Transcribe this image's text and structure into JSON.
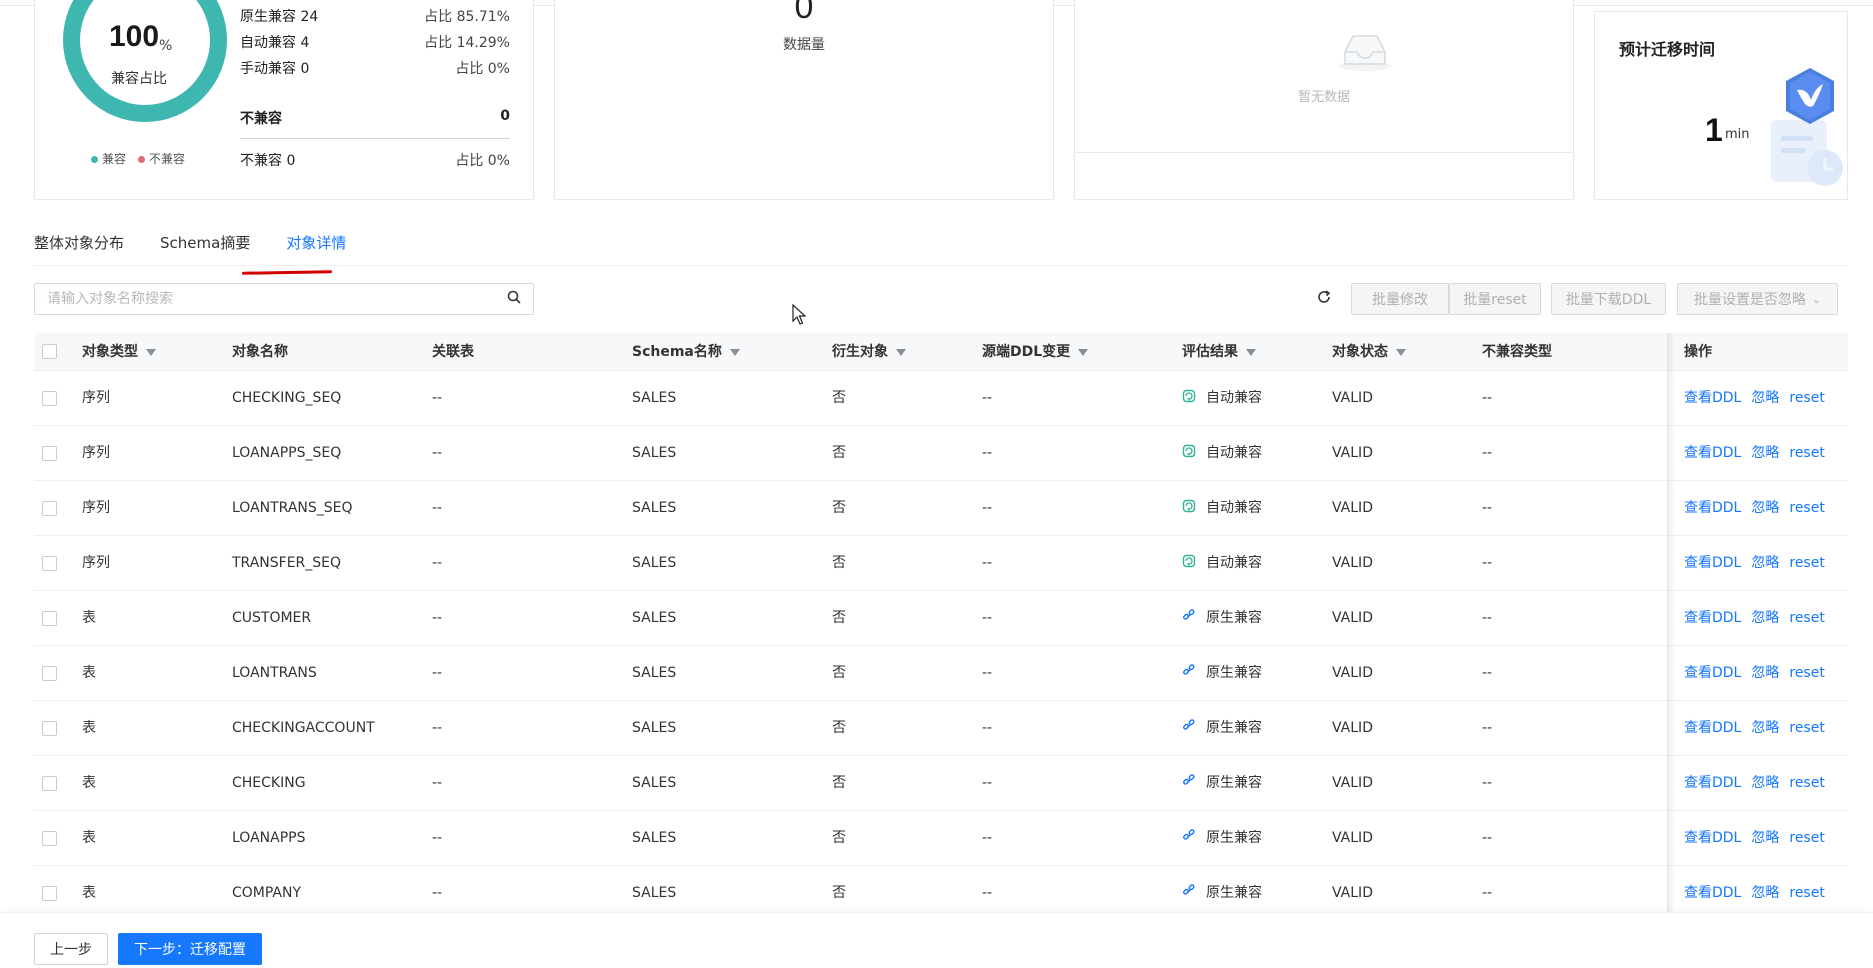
{
  "summary": {
    "donut": {
      "value": "100",
      "unit": "%",
      "label": "兼容占比",
      "compatible_color": "#3fb7b1",
      "incompatible_color": "#e06c6c"
    },
    "legend": {
      "compatible": "兼容",
      "incompatible": "不兼容"
    },
    "stats": [
      {
        "label": "原生兼容 24",
        "ratio": "占比 85.71%"
      },
      {
        "label": "自动兼容 4",
        "ratio": "占比 14.29%"
      },
      {
        "label": "手动兼容 0",
        "ratio": "占比 0%"
      }
    ],
    "incompat_header": {
      "label": "不兼容",
      "value": "0"
    },
    "incompat_row": {
      "label": "不兼容 0",
      "ratio": "占比 0%"
    },
    "data_card": {
      "value": "0",
      "label": "数据量"
    },
    "empty_card": {
      "text": "暂无数据"
    },
    "migration_card": {
      "title": "预计迁移时间",
      "value": "1",
      "unit": "min"
    }
  },
  "tabs": [
    {
      "label": "整体对象分布",
      "active": false
    },
    {
      "label": "Schema摘要",
      "active": false
    },
    {
      "label": "对象详情",
      "active": true
    }
  ],
  "search": {
    "placeholder": "请输入对象名称搜索",
    "value": ""
  },
  "toolbar": {
    "batch_modify": "批量修改",
    "batch_reset": "批量reset",
    "batch_download": "批量下载DDL",
    "batch_ignore": "批量设置是否忽略"
  },
  "table": {
    "headers": {
      "type": "对象类型",
      "name": "对象名称",
      "related": "关联表",
      "schema": "Schema名称",
      "derived": "衍生对象",
      "ddl_change": "源端DDL变更",
      "eval": "评估结果",
      "status": "对象状态",
      "incompat_type": "不兼容类型",
      "ops": "操作"
    },
    "ops": {
      "view_ddl": "查看DDL",
      "ignore": "忽略",
      "reset": "reset"
    },
    "rows": [
      {
        "type": "序列",
        "name": "CHECKING_SEQ",
        "related": "--",
        "schema": "SALES",
        "derived": "否",
        "ddl_change": "--",
        "eval": "自动兼容",
        "eval_icon": "auto-compat-icon",
        "status": "VALID",
        "incompat_type": "--"
      },
      {
        "type": "序列",
        "name": "LOANAPPS_SEQ",
        "related": "--",
        "schema": "SALES",
        "derived": "否",
        "ddl_change": "--",
        "eval": "自动兼容",
        "eval_icon": "auto-compat-icon",
        "status": "VALID",
        "incompat_type": "--"
      },
      {
        "type": "序列",
        "name": "LOANTRANS_SEQ",
        "related": "--",
        "schema": "SALES",
        "derived": "否",
        "ddl_change": "--",
        "eval": "自动兼容",
        "eval_icon": "auto-compat-icon",
        "status": "VALID",
        "incompat_type": "--"
      },
      {
        "type": "序列",
        "name": "TRANSFER_SEQ",
        "related": "--",
        "schema": "SALES",
        "derived": "否",
        "ddl_change": "--",
        "eval": "自动兼容",
        "eval_icon": "auto-compat-icon",
        "status": "VALID",
        "incompat_type": "--"
      },
      {
        "type": "表",
        "name": "CUSTOMER",
        "related": "--",
        "schema": "SALES",
        "derived": "否",
        "ddl_change": "--",
        "eval": "原生兼容",
        "eval_icon": "native-compat-icon",
        "status": "VALID",
        "incompat_type": "--"
      },
      {
        "type": "表",
        "name": "LOANTRANS",
        "related": "--",
        "schema": "SALES",
        "derived": "否",
        "ddl_change": "--",
        "eval": "原生兼容",
        "eval_icon": "native-compat-icon",
        "status": "VALID",
        "incompat_type": "--"
      },
      {
        "type": "表",
        "name": "CHECKINGACCOUNT",
        "related": "--",
        "schema": "SALES",
        "derived": "否",
        "ddl_change": "--",
        "eval": "原生兼容",
        "eval_icon": "native-compat-icon",
        "status": "VALID",
        "incompat_type": "--"
      },
      {
        "type": "表",
        "name": "CHECKING",
        "related": "--",
        "schema": "SALES",
        "derived": "否",
        "ddl_change": "--",
        "eval": "原生兼容",
        "eval_icon": "native-compat-icon",
        "status": "VALID",
        "incompat_type": "--"
      },
      {
        "type": "表",
        "name": "LOANAPPS",
        "related": "--",
        "schema": "SALES",
        "derived": "否",
        "ddl_change": "--",
        "eval": "原生兼容",
        "eval_icon": "native-compat-icon",
        "status": "VALID",
        "incompat_type": "--"
      },
      {
        "type": "表",
        "name": "COMPANY",
        "related": "--",
        "schema": "SALES",
        "derived": "否",
        "ddl_change": "--",
        "eval": "原生兼容",
        "eval_icon": "native-compat-icon",
        "status": "VALID",
        "incompat_type": "--"
      }
    ]
  },
  "footer": {
    "prev": "上一步",
    "next": "下一步：迁移配置"
  },
  "colors": {
    "accent": "#1677ff",
    "teal": "#3fb7b1",
    "annotation_red": "#d40000"
  }
}
